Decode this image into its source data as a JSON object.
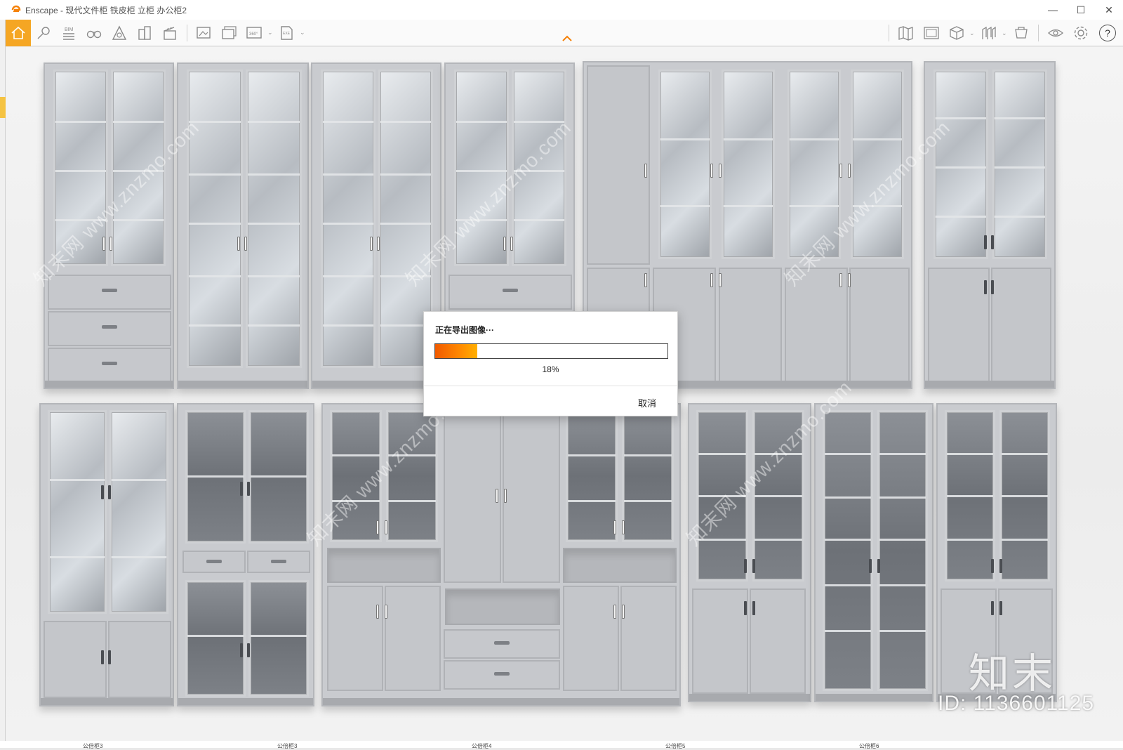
{
  "window": {
    "title": "Enscape - 现代文件柜 铁皮柜 立柜 办公柜2",
    "minimize_glyph": "—",
    "maximize_glyph": "☐",
    "close_glyph": "✕"
  },
  "toolbar": {
    "left_tools": [
      "home-icon",
      "capture-icon",
      "bim-icon",
      "binoculars-icon",
      "atmosphere-icon",
      "buildings-icon",
      "clapper-icon",
      "screenshot-icon",
      "batch-render-icon",
      "panorama-360-icon",
      "export-icon"
    ],
    "bim_label": "BIM",
    "pano_label": "360°",
    "exe_label": "EXE",
    "right_tools": [
      "map-icon",
      "sketch-icon",
      "cube-icon",
      "orthographic-icon",
      "asset-library-icon",
      "view-icon",
      "settings-icon",
      "help-icon"
    ],
    "help_glyph": "?",
    "accent_color": "#f5a623"
  },
  "viewport": {
    "watermark_text": "www.znzmo.com",
    "watermark_cn": "知末网",
    "watermark_logo": "知末",
    "watermark_id": "ID: 1136601125",
    "bottom_labels": [
      "公倍柜3",
      "公倍柜3",
      "公倍柜4",
      "公倍柜5",
      "公倍柜6"
    ]
  },
  "dialog": {
    "title": "正在导出图像···",
    "progress_fraction": 0.18,
    "progress_text": "18%",
    "cancel_label": "取消",
    "progress_color": "#f5820a"
  }
}
